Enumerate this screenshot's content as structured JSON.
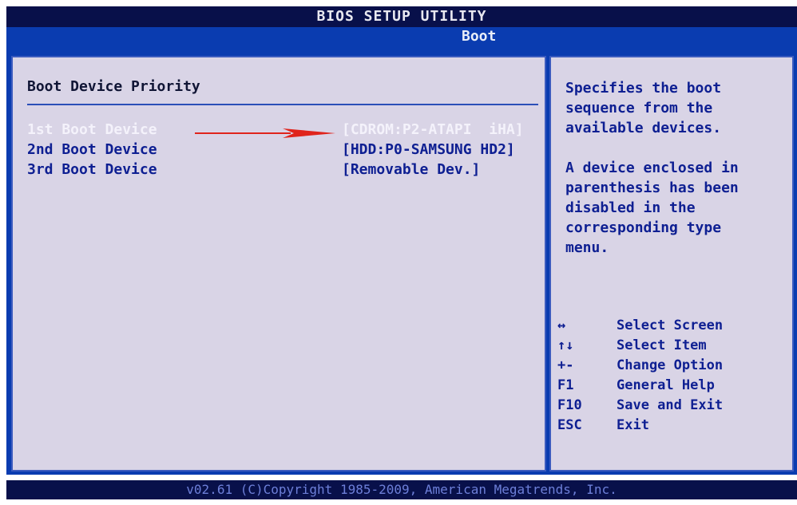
{
  "header": {
    "title": "BIOS SETUP UTILITY",
    "active_tab": "Boot"
  },
  "main": {
    "section_title": "Boot Device Priority",
    "rows": [
      {
        "label": "1st Boot Device",
        "value": "[CDROM:P2-ATAPI  iHA]",
        "selected": true
      },
      {
        "label": "2nd Boot Device",
        "value": "[HDD:P0-SAMSUNG HD2]",
        "selected": false
      },
      {
        "label": "3rd Boot Device",
        "value": "[Removable Dev.]",
        "selected": false
      }
    ]
  },
  "help": {
    "paragraph1": "Specifies the boot\nsequence from the\navailable devices.",
    "paragraph2": "A device enclosed in\nparenthesis has been\ndisabled in the\ncorresponding type\nmenu.",
    "keys": [
      {
        "key": "↔",
        "desc": "Select Screen"
      },
      {
        "key": "↑↓",
        "desc": "Select Item"
      },
      {
        "key": "+-",
        "desc": "Change Option"
      },
      {
        "key": "F1",
        "desc": "General Help"
      },
      {
        "key": "F10",
        "desc": "Save and Exit"
      },
      {
        "key": "ESC",
        "desc": "Exit"
      }
    ]
  },
  "footer": {
    "text": "v02.61 (C)Copyright 1985-2009, American Megatrends, Inc."
  },
  "colors": {
    "title_bar": "#08104a",
    "menu_bar": "#0a3cb0",
    "panel_bg": "#d9d4e6",
    "text": "#0e1f92",
    "selected_text": "#f4f2fb",
    "arrow": "#e0241c"
  }
}
